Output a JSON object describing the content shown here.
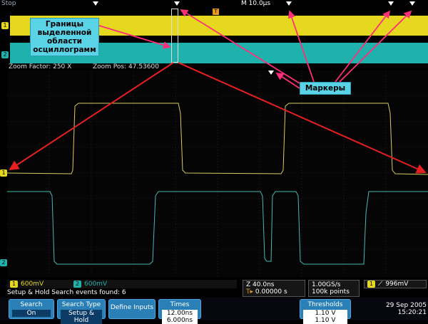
{
  "status": {
    "acq": "Stop",
    "timebase": "M 10.0µs"
  },
  "overview": {
    "ch1_label": "1",
    "ch2_label": "2",
    "trig_label": "T"
  },
  "zoom": {
    "factor": "Zoom Factor: 250 X",
    "pos": "Zoom Pos: 47.53600"
  },
  "callouts": {
    "selected_area": "Границы выделенной области осциллограмм",
    "markers": "Маркеры"
  },
  "channels": {
    "ch1": {
      "badge": "1",
      "scale": "600mV",
      "color": "#e6d81e"
    },
    "ch2": {
      "badge": "2",
      "scale": "600mV",
      "color": "#1fb2ad"
    }
  },
  "timing": {
    "z": "Z 40.0ns",
    "trig_pos": "0.00000 s"
  },
  "sampling": {
    "rate": "1.00GS/s",
    "points": "100k points"
  },
  "trigger": {
    "badge": "1",
    "level": "996mV"
  },
  "search_status": "Setup & Hold Search events found: 6",
  "menu": {
    "search": {
      "label": "Search",
      "value": "On"
    },
    "search_type": {
      "label": "Search Type",
      "value": "Setup & Hold"
    },
    "define_inputs": {
      "label": "Define Inputs"
    },
    "times": {
      "label": "Times",
      "v1": "12.00ns",
      "v2": "6.000ns"
    },
    "thresholds": {
      "label": "Thresholds",
      "v1": "1.10 V",
      "v2": "1.10 V"
    }
  },
  "datetime": {
    "date": "29 Sep 2005",
    "time": "15:20:21"
  },
  "colors": {
    "yellow": "#e6d81e",
    "cyan": "#1fb2ad",
    "arrow": "#ff2e7a",
    "red": "#e62020"
  }
}
